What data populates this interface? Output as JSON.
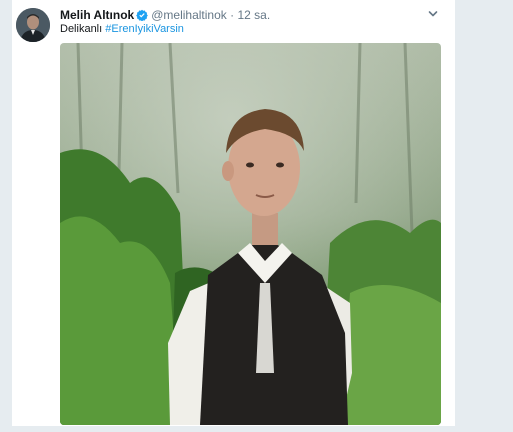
{
  "tweet": {
    "display_name": "Melih Altınok",
    "handle": "@melihaltinok",
    "separator": "·",
    "time": "12 sa.",
    "text": "Delikanlı ",
    "hashtag": "#ErenIyikiVarsin",
    "verified_icon": "verified-badge-icon",
    "more_icon": "chevron-down-icon"
  },
  "colors": {
    "accent": "#1b95e0",
    "muted": "#657786",
    "background_edge": "#e6ecf0"
  }
}
